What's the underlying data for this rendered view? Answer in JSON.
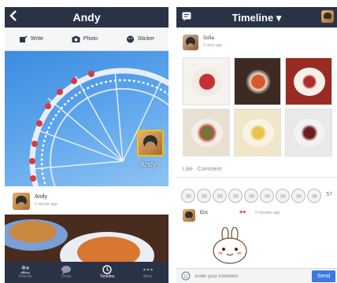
{
  "left": {
    "header": {
      "title": "Andy",
      "back_icon": "chevron-left-icon"
    },
    "actions": [
      {
        "label": "Write",
        "icon": "edit-icon"
      },
      {
        "label": "Photo",
        "icon": "camera-icon"
      },
      {
        "label": "Sticker",
        "icon": "sticker-icon"
      }
    ],
    "profile": {
      "name": "Andy"
    },
    "post": {
      "name": "Andy",
      "time": "1 minute ago"
    },
    "tabs": [
      {
        "label": "Friends",
        "icon": "friends-icon",
        "active": false
      },
      {
        "label": "Chats",
        "icon": "chat-icon",
        "active": false
      },
      {
        "label": "Timeline",
        "icon": "clock-icon",
        "active": true
      },
      {
        "label": "More",
        "icon": "more-icon",
        "active": false
      }
    ]
  },
  "right": {
    "header": {
      "title": "Timeline ▾",
      "compose_icon": "compose-icon"
    },
    "post": {
      "name": "Sofia",
      "time": "3 mins ago"
    },
    "like_comment": "Like · Comment",
    "like_count": "57",
    "comment": {
      "name": "Eric",
      "hearts": "♥♥",
      "time": "2 minutes ago"
    },
    "input": {
      "placeholder": "Enter your comment",
      "send_label": "Send",
      "emoji_icon": "smile-icon"
    }
  },
  "colors": {
    "header": "#2a3346",
    "accent": "#3a79e0"
  }
}
